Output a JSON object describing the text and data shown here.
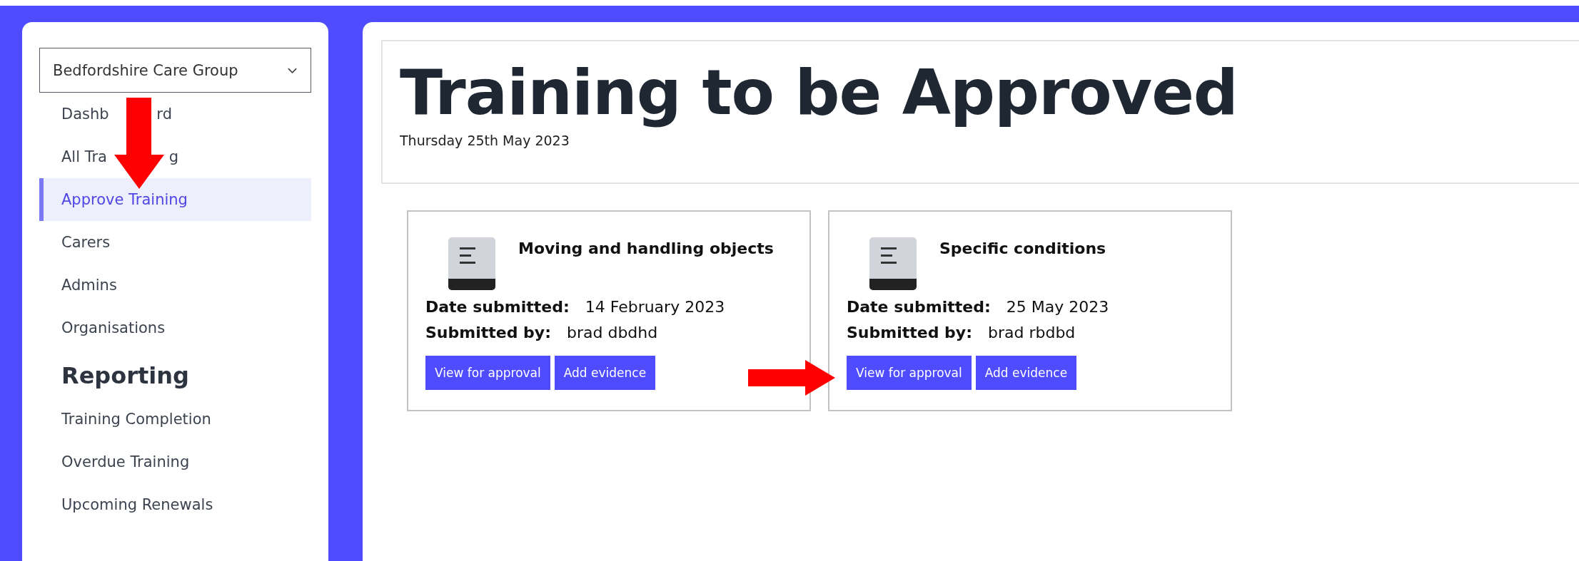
{
  "sidebar": {
    "organisation_select": {
      "value": "Bedfordshire Care Group"
    },
    "items": [
      {
        "label": "Dashb          rd",
        "selected": false
      },
      {
        "label": "All Tra             g",
        "selected": false
      },
      {
        "label": "Approve Training",
        "selected": true
      },
      {
        "label": "Carers",
        "selected": false
      },
      {
        "label": "Admins",
        "selected": false
      },
      {
        "label": "Organisations",
        "selected": false
      }
    ],
    "sections": [
      {
        "heading": "Reporting",
        "items": [
          {
            "label": "Training Completion",
            "selected": false
          },
          {
            "label": "Overdue Training",
            "selected": false
          },
          {
            "label": "Upcoming Renewals",
            "selected": false
          }
        ]
      }
    ]
  },
  "page": {
    "title": "Training to be Approved",
    "date": "Thursday 25th May 2023"
  },
  "cards": [
    {
      "title": "Moving and handling objects",
      "fields": [
        {
          "label": "Date submitted:",
          "value": "14 February 2023"
        },
        {
          "label": "Submitted by:",
          "value": "brad dbdhd"
        }
      ],
      "buttons": [
        "View for approval",
        "Add evidence"
      ]
    },
    {
      "title": "Specific conditions",
      "fields": [
        {
          "label": "Date submitted:",
          "value": "25 May 2023"
        },
        {
          "label": "Submitted by:",
          "value": "brad rbdbd"
        }
      ],
      "buttons": [
        "View for approval",
        "Add evidence"
      ]
    }
  ],
  "annotations": [
    {
      "kind": "down"
    },
    {
      "kind": "right"
    }
  ]
}
